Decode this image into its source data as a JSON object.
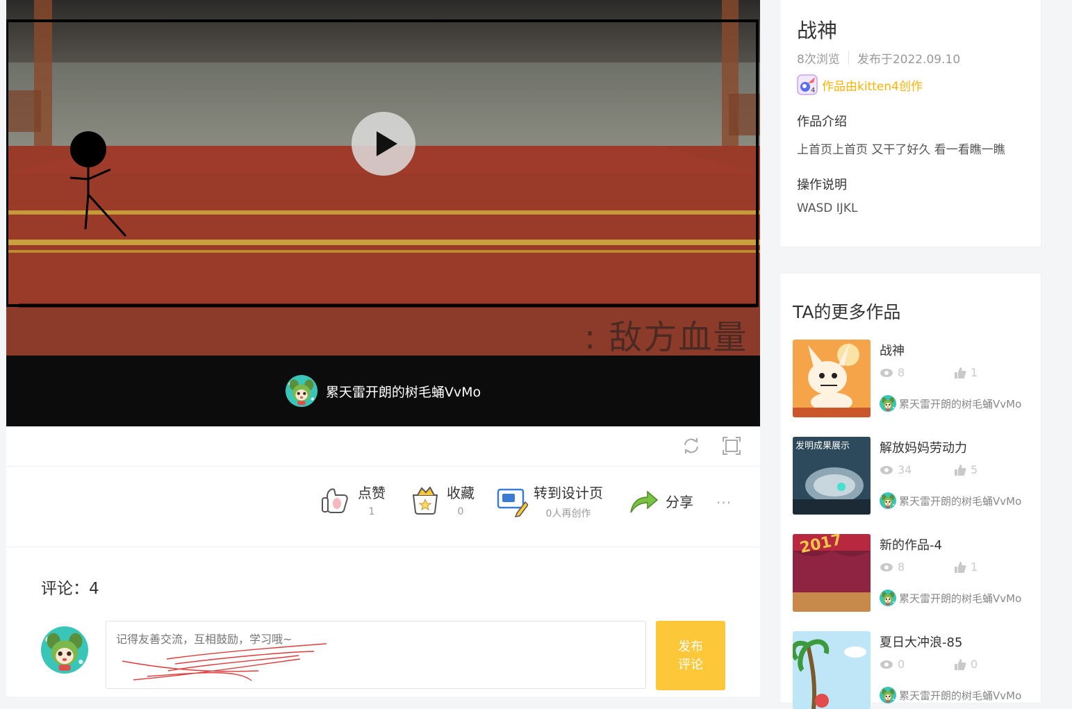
{
  "player": {
    "overlay_text": ": 敌方血量",
    "author_name": "累天雷开朗的树毛蛹VvMo"
  },
  "actions": {
    "like": {
      "label": "点赞",
      "count": "1"
    },
    "collect": {
      "label": "收藏",
      "count": "0"
    },
    "design": {
      "label": "转到设计页",
      "sub": "0人再创作"
    },
    "share": {
      "label": "分享"
    },
    "more": "···"
  },
  "comments": {
    "title": "评论：4",
    "placeholder": "记得友善交流，互相鼓励，学习哦~",
    "submit_line1": "发布",
    "submit_line2": "评论"
  },
  "info": {
    "title": "战神",
    "views": "8次浏览",
    "published": "发布于2022.09.10",
    "creator": "作品由kitten4创作",
    "intro_heading": "作品介绍",
    "intro_text": "上首页上首页 又干了好久 看一看瞧一瞧",
    "controls_heading": "操作说明",
    "controls_text": "WASD IJKL"
  },
  "more_works": {
    "heading": "TA的更多作品",
    "items": [
      {
        "title": "战神",
        "views": "8",
        "likes": "1",
        "author": "累天雷开朗的树毛蛹VvMo",
        "thumb_text": ""
      },
      {
        "title": "解放妈妈劳动力",
        "views": "34",
        "likes": "5",
        "author": "累天雷开朗的树毛蛹VvMo",
        "thumb_text": "发明成果展示"
      },
      {
        "title": "新的作品-4",
        "views": "8",
        "likes": "1",
        "author": "累天雷开朗的树毛蛹VvMo",
        "thumb_text": "2017"
      },
      {
        "title": "夏日大冲浪-85",
        "views": "0",
        "likes": "0",
        "author": "累天雷开朗的树毛蛹VvMo",
        "thumb_text": ""
      }
    ]
  },
  "colors": {
    "accent_yellow": "#fcc83a",
    "creator_gold": "#fcb300",
    "player_bg": "#0c0c0c"
  }
}
